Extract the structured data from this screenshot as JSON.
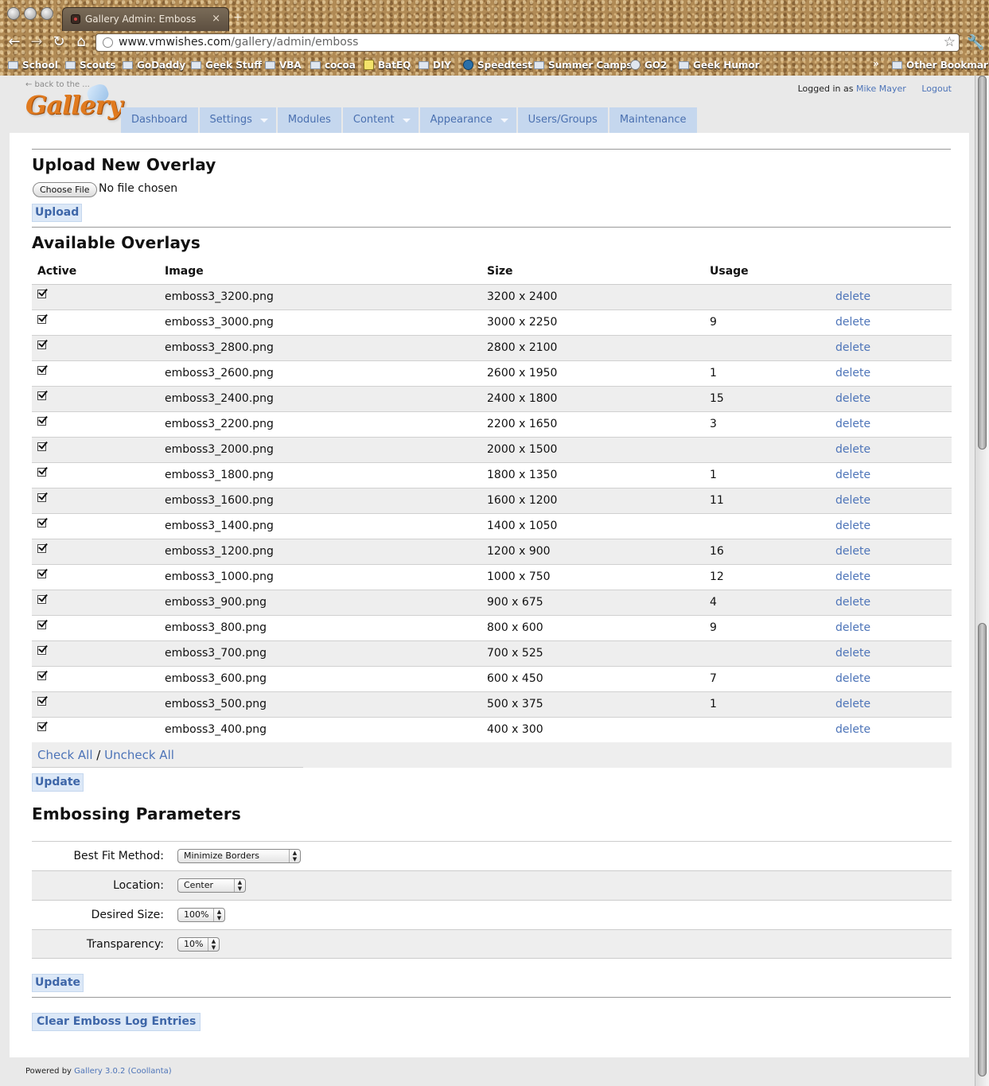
{
  "browser": {
    "tab_title": "Gallery Admin: Emboss",
    "tab_close": "×",
    "new_tab": "+",
    "url_host": "www.vmwishes.com",
    "url_path": "/gallery/admin/emboss",
    "bookmarks": [
      "School",
      "Scouts",
      "GoDaddy",
      "Geek Stuff",
      "VBA",
      "cocoa",
      "BatEQ",
      "DIY",
      "Speedtest",
      "Summer Camps",
      "GO2",
      "Geek Humor"
    ],
    "bookmark_overflow": "»",
    "other_bookmarks": "Other Bookmarks"
  },
  "header": {
    "back_to": "← back to the ...",
    "logo_text": "Gallery",
    "logged_in_prefix": "Logged in as",
    "user_name": "Mike Mayer",
    "logout": "Logout",
    "nav": [
      "Dashboard",
      "Settings",
      "Modules",
      "Content",
      "Appearance",
      "Users/Groups",
      "Maintenance"
    ]
  },
  "upload": {
    "heading": "Upload New Overlay",
    "choose_file": "Choose File",
    "no_file": "No file chosen",
    "upload_button": "Upload"
  },
  "overlays": {
    "heading": "Available Overlays",
    "columns": [
      "Active",
      "Image",
      "Size",
      "Usage"
    ],
    "delete_label": "delete",
    "rows": [
      {
        "image": "emboss3_3200.png",
        "size": "3200 x 2400",
        "usage": ""
      },
      {
        "image": "emboss3_3000.png",
        "size": "3000 x 2250",
        "usage": "9"
      },
      {
        "image": "emboss3_2800.png",
        "size": "2800 x 2100",
        "usage": ""
      },
      {
        "image": "emboss3_2600.png",
        "size": "2600 x 1950",
        "usage": "1"
      },
      {
        "image": "emboss3_2400.png",
        "size": "2400 x 1800",
        "usage": "15"
      },
      {
        "image": "emboss3_2200.png",
        "size": "2200 x 1650",
        "usage": "3"
      },
      {
        "image": "emboss3_2000.png",
        "size": "2000 x 1500",
        "usage": ""
      },
      {
        "image": "emboss3_1800.png",
        "size": "1800 x 1350",
        "usage": "1"
      },
      {
        "image": "emboss3_1600.png",
        "size": "1600 x 1200",
        "usage": "11"
      },
      {
        "image": "emboss3_1400.png",
        "size": "1400 x 1050",
        "usage": ""
      },
      {
        "image": "emboss3_1200.png",
        "size": "1200 x 900",
        "usage": "16"
      },
      {
        "image": "emboss3_1000.png",
        "size": "1000 x 750",
        "usage": "12"
      },
      {
        "image": "emboss3_900.png",
        "size": "900 x 675",
        "usage": "4"
      },
      {
        "image": "emboss3_800.png",
        "size": "800 x 600",
        "usage": "9"
      },
      {
        "image": "emboss3_700.png",
        "size": "700 x 525",
        "usage": ""
      },
      {
        "image": "emboss3_600.png",
        "size": "600 x 450",
        "usage": "7"
      },
      {
        "image": "emboss3_500.png",
        "size": "500 x 375",
        "usage": "1"
      },
      {
        "image": "emboss3_400.png",
        "size": "400 x 300",
        "usage": ""
      }
    ],
    "check_all": "Check All",
    "separator": "/",
    "uncheck_all": "Uncheck All",
    "update_button": "Update"
  },
  "params": {
    "heading": "Embossing Parameters",
    "best_fit_label": "Best Fit Method:",
    "best_fit_value": "Minimize Borders",
    "location_label": "Location:",
    "location_value": "Center",
    "size_label": "Desired Size:",
    "size_value": "100%",
    "transparency_label": "Transparency:",
    "transparency_value": "10%",
    "update_button": "Update",
    "clear_log_button": "Clear Emboss Log Entries"
  },
  "footer": {
    "powered_by": "Powered by",
    "version_link": "Gallery 3.0.2 (Coollanta)"
  }
}
